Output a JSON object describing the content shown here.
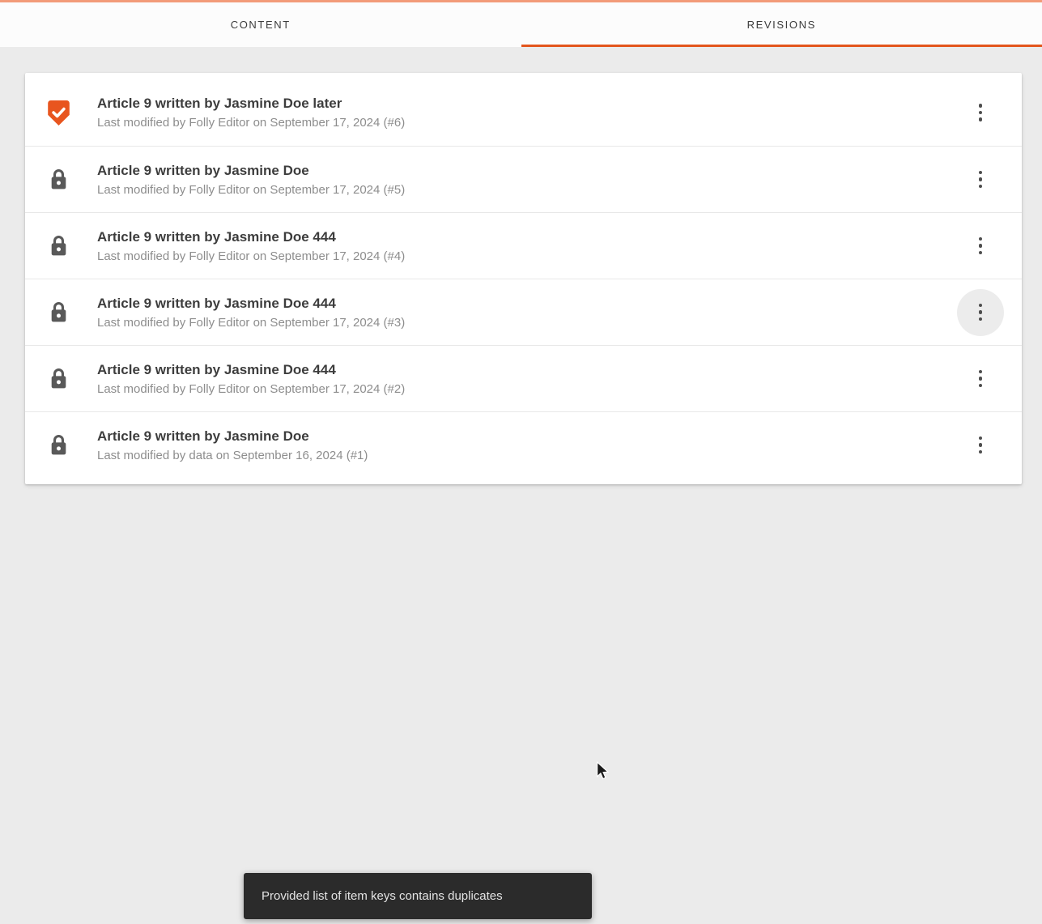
{
  "colors": {
    "accent": "#e3561d",
    "top_line": "#f29b79",
    "shield": "#e8551f",
    "lock": "#595959",
    "page_bg": "#ebebeb",
    "card_bg": "#ffffff",
    "toast_bg": "#2b2b2b",
    "kebab_hover_bg": "#ececec"
  },
  "tabs": [
    {
      "label": "CONTENT",
      "active": false
    },
    {
      "label": "REVISIONS",
      "active": true
    }
  ],
  "revisions": [
    {
      "icon": "approved-shield-icon",
      "title": "Article 9 written by Jasmine Doe later",
      "subtitle": "Last modified by Folly Editor on September 17, 2024 (#6)",
      "menu_hover": false
    },
    {
      "icon": "lock-icon",
      "title": "Article 9 written by Jasmine Doe",
      "subtitle": "Last modified by Folly Editor on September 17, 2024 (#5)",
      "menu_hover": false
    },
    {
      "icon": "lock-icon",
      "title": "Article 9 written by Jasmine Doe 444",
      "subtitle": "Last modified by Folly Editor on September 17, 2024 (#4)",
      "menu_hover": false
    },
    {
      "icon": "lock-icon",
      "title": "Article 9 written by Jasmine Doe 444",
      "subtitle": "Last modified by Folly Editor on September 17, 2024 (#3)",
      "menu_hover": true
    },
    {
      "icon": "lock-icon",
      "title": "Article 9 written by Jasmine Doe 444",
      "subtitle": "Last modified by Folly Editor on September 17, 2024 (#2)",
      "menu_hover": false
    },
    {
      "icon": "lock-icon",
      "title": "Article 9 written by Jasmine Doe",
      "subtitle": "Last modified by data on September 16, 2024 (#1)",
      "menu_hover": false
    }
  ],
  "toast": {
    "message": "Provided list of item keys contains duplicates"
  }
}
